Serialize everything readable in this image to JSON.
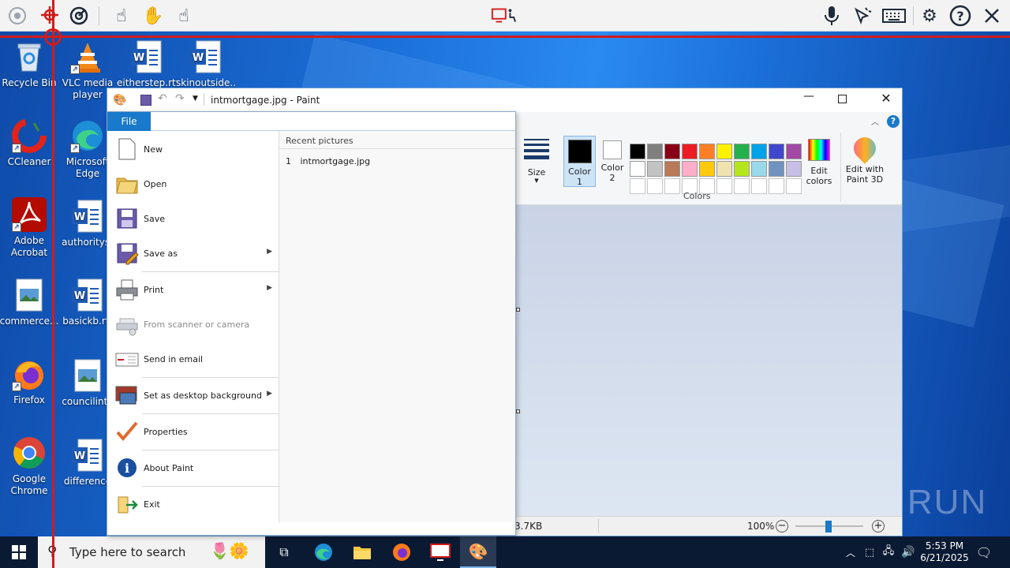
{
  "desktop": {
    "icons": [
      {
        "label": "Recycle Bin",
        "icon": "recycle-bin-icon"
      },
      {
        "label": "VLC media player",
        "icon": "vlc-icon"
      },
      {
        "label": "eitherstep.rtf",
        "icon": "word-doc-icon"
      },
      {
        "label": "skinoutside...",
        "icon": "word-doc-icon"
      },
      {
        "label": "CCleaner",
        "icon": "ccleaner-icon"
      },
      {
        "label": "Microsoft Edge",
        "icon": "edge-icon"
      },
      {
        "label": "Adobe Acrobat",
        "icon": "acrobat-icon"
      },
      {
        "label": "authorityst",
        "icon": "word-doc-icon"
      },
      {
        "label": "commerce...",
        "icon": "image-file-icon"
      },
      {
        "label": "basickb.rtf",
        "icon": "word-doc-icon"
      },
      {
        "label": "Firefox",
        "icon": "firefox-icon"
      },
      {
        "label": "councilinte",
        "icon": "image-file-icon"
      },
      {
        "label": "Google Chrome",
        "icon": "chrome-icon"
      },
      {
        "label": "difference",
        "icon": "word-doc-icon"
      }
    ]
  },
  "paint": {
    "title": "intmortgage.jpg - Paint",
    "file_tab": "File",
    "ribbon": {
      "size_label": "Size",
      "color1_label": "Color 1",
      "color2_label": "Color 2",
      "edit_colors_label": "Edit colors",
      "edit_paint3d_label": "Edit with Paint 3D",
      "colors_group_label": "Colors",
      "palette_row1": [
        "#000000",
        "#7f7f7f",
        "#880015",
        "#ed1c24",
        "#ff7f27",
        "#fff200",
        "#22b14c",
        "#00a2e8",
        "#3f48cc",
        "#a349a4"
      ],
      "palette_row2": [
        "#ffffff",
        "#c3c3c3",
        "#b97a57",
        "#ffaec9",
        "#ffc90e",
        "#efe4b0",
        "#b5e61d",
        "#99d9ea",
        "#7092be",
        "#c8bfe7"
      ]
    },
    "status": {
      "size": "3.7KB",
      "zoom": "100%"
    }
  },
  "file_menu": {
    "items": [
      {
        "label": "New",
        "icon": "new-file-icon"
      },
      {
        "label": "Open",
        "icon": "open-folder-icon"
      },
      {
        "label": "Save",
        "icon": "save-icon"
      },
      {
        "label": "Save as",
        "icon": "save-as-icon"
      },
      {
        "label": "Print",
        "icon": "print-icon"
      },
      {
        "label": "From scanner or camera",
        "icon": "scanner-icon"
      },
      {
        "label": "Send in email",
        "icon": "email-icon"
      },
      {
        "label": "Set as desktop background",
        "icon": "desktop-background-icon"
      },
      {
        "label": "Properties",
        "icon": "properties-check-icon"
      },
      {
        "label": "About Paint",
        "icon": "info-icon"
      },
      {
        "label": "Exit",
        "icon": "exit-icon"
      }
    ],
    "recent_header": "Recent pictures",
    "recent_items": [
      {
        "index": "1",
        "name": "intmortgage.jpg"
      }
    ]
  },
  "taskbar": {
    "search_placeholder": "Type here to search",
    "time": "5:53 PM",
    "date": "6/21/2025"
  },
  "watermark": "ANY RUN"
}
